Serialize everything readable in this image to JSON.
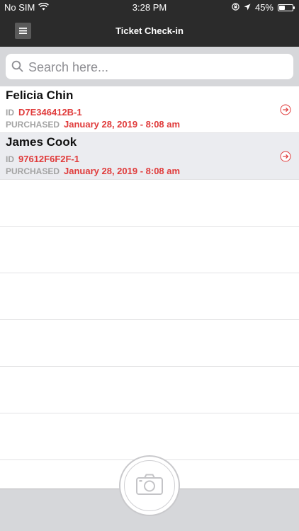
{
  "status_bar": {
    "carrier": "No SIM",
    "time": "3:28 PM",
    "battery": "45%",
    "battery_level": 0.45,
    "icons": [
      "wifi-icon",
      "screen-lock-icon",
      "location-icon",
      "battery-icon"
    ]
  },
  "nav": {
    "title": "Ticket Check-in",
    "menu_icon": "hamburger-menu-icon"
  },
  "search": {
    "placeholder": "Search here..."
  },
  "attendees": [
    {
      "name": "Felicia Chin",
      "id_label": "ID",
      "id": "D7E346412B-1",
      "purchased_label": "PURCHASED",
      "purchased": "January 28, 2019 - 8:08 am"
    },
    {
      "name": "James Cook",
      "id_label": "ID",
      "id": "97612F6F2F-1",
      "purchased_label": "PURCHASED",
      "purchased": "January 28, 2019 - 8:08 am"
    }
  ],
  "colors": {
    "header_bg": "#2b2b2b",
    "accent_red": "#e03b3b",
    "search_bg": "#d6d7da",
    "alt_row_bg": "#ebecf0",
    "label_gray": "#a3a3a3"
  },
  "bottom": {
    "camera_icon": "camera-icon"
  }
}
